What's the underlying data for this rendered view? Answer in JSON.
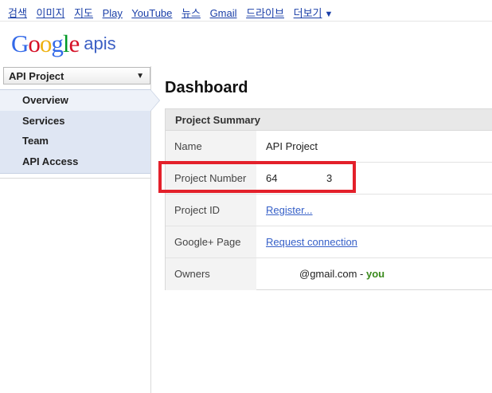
{
  "gbar": {
    "links": [
      "검색",
      "이미지",
      "지도",
      "Play",
      "YouTube",
      "뉴스",
      "Gmail",
      "드라이브",
      "더보기"
    ],
    "more_arrow": "▼"
  },
  "logo": {
    "word": "Google",
    "suffix": "apis",
    "letter_colors": [
      "#3369e8",
      "#d50f25",
      "#eeb211",
      "#3369e8",
      "#009925",
      "#d50f25"
    ]
  },
  "sidebar": {
    "project_select": "API Project",
    "select_arrow": "▼",
    "nav": [
      {
        "label": "Overview",
        "active": true
      },
      {
        "label": "Services",
        "active": false
      },
      {
        "label": "Team",
        "active": false
      },
      {
        "label": "API Access",
        "active": false
      }
    ]
  },
  "main": {
    "title": "Dashboard",
    "summary": {
      "header": "Project Summary",
      "rows": {
        "name": {
          "label": "Name",
          "value": "API Project"
        },
        "number": {
          "label": "Project Number",
          "value_left": "64",
          "value_right": "3"
        },
        "id": {
          "label": "Project ID",
          "value": "Register..."
        },
        "gplus": {
          "label": "Google+ Page",
          "value": "Request connection"
        },
        "owners": {
          "label": "Owners",
          "email": "@gmail.com",
          "separator": " - ",
          "you": "you"
        }
      }
    }
  },
  "colors": {
    "highlight": "#e3202a",
    "link": "#3660c8",
    "you": "#3a8a1c"
  }
}
